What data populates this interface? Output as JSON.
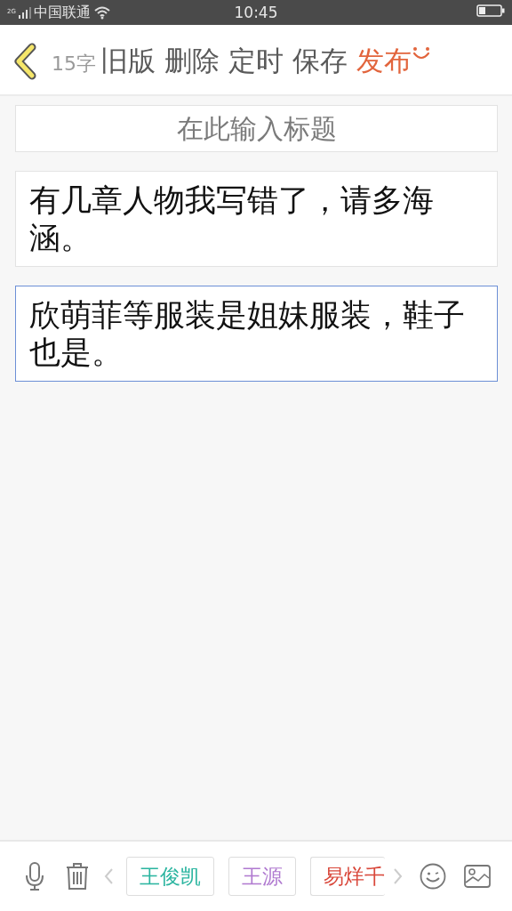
{
  "status_bar": {
    "network": "2G",
    "carrier": "中国联通",
    "time": "10:45"
  },
  "toolbar": {
    "word_count": "15字",
    "actions": [
      {
        "label": "旧版",
        "kind": "normal"
      },
      {
        "label": "删除",
        "kind": "normal"
      },
      {
        "label": "定时",
        "kind": "normal"
      },
      {
        "label": "保存",
        "kind": "normal"
      },
      {
        "label": "发布",
        "kind": "primary"
      }
    ]
  },
  "title_field": {
    "placeholder": "在此输入标题"
  },
  "paragraphs": [
    {
      "text": "有几章人物我写错了，请多海涵。",
      "selected": false
    },
    {
      "text": "欣萌菲等服装是姐妹服装，鞋子也是。",
      "selected": true
    }
  ],
  "bottom_bar": {
    "tags": [
      {
        "label": "王俊凯",
        "color": "#2bb5a0"
      },
      {
        "label": "王源",
        "color": "#b07ad0"
      },
      {
        "label": "易烊千",
        "color": "#d9473a"
      }
    ]
  }
}
